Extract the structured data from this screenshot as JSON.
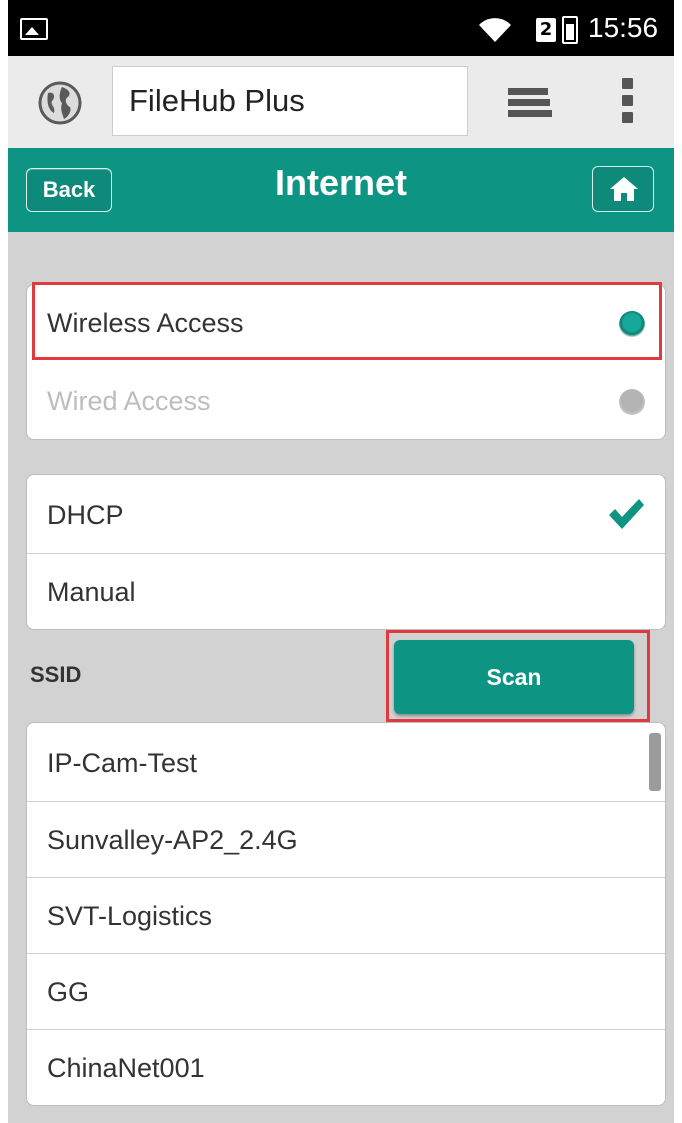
{
  "status_bar": {
    "time": "15:56",
    "sim_label": "2",
    "icons": [
      "image-icon",
      "wifi-icon",
      "sim-icon",
      "battery-icon"
    ]
  },
  "app_bar": {
    "title": "FileHub Plus",
    "icons": [
      "globe-icon",
      "stack-icon",
      "more-icon"
    ]
  },
  "header": {
    "back_label": "Back",
    "title": "Internet",
    "home_icon": "home-icon"
  },
  "access": {
    "items": [
      {
        "label": "Wireless Access",
        "selected": true,
        "enabled": true
      },
      {
        "label": "Wired Access",
        "selected": false,
        "enabled": false
      }
    ]
  },
  "ip_mode": {
    "items": [
      {
        "label": "DHCP",
        "checked": true
      },
      {
        "label": "Manual",
        "checked": false
      }
    ]
  },
  "ssid": {
    "label": "SSID",
    "scan_label": "Scan"
  },
  "networks": [
    "IP-Cam-Test",
    "Sunvalley-AP2_2.4G",
    "SVT-Logistics",
    "GG",
    "ChinaNet001"
  ],
  "colors": {
    "accent": "#0e9483",
    "highlight": "#e03a3e",
    "background": "#d2d2d2"
  }
}
